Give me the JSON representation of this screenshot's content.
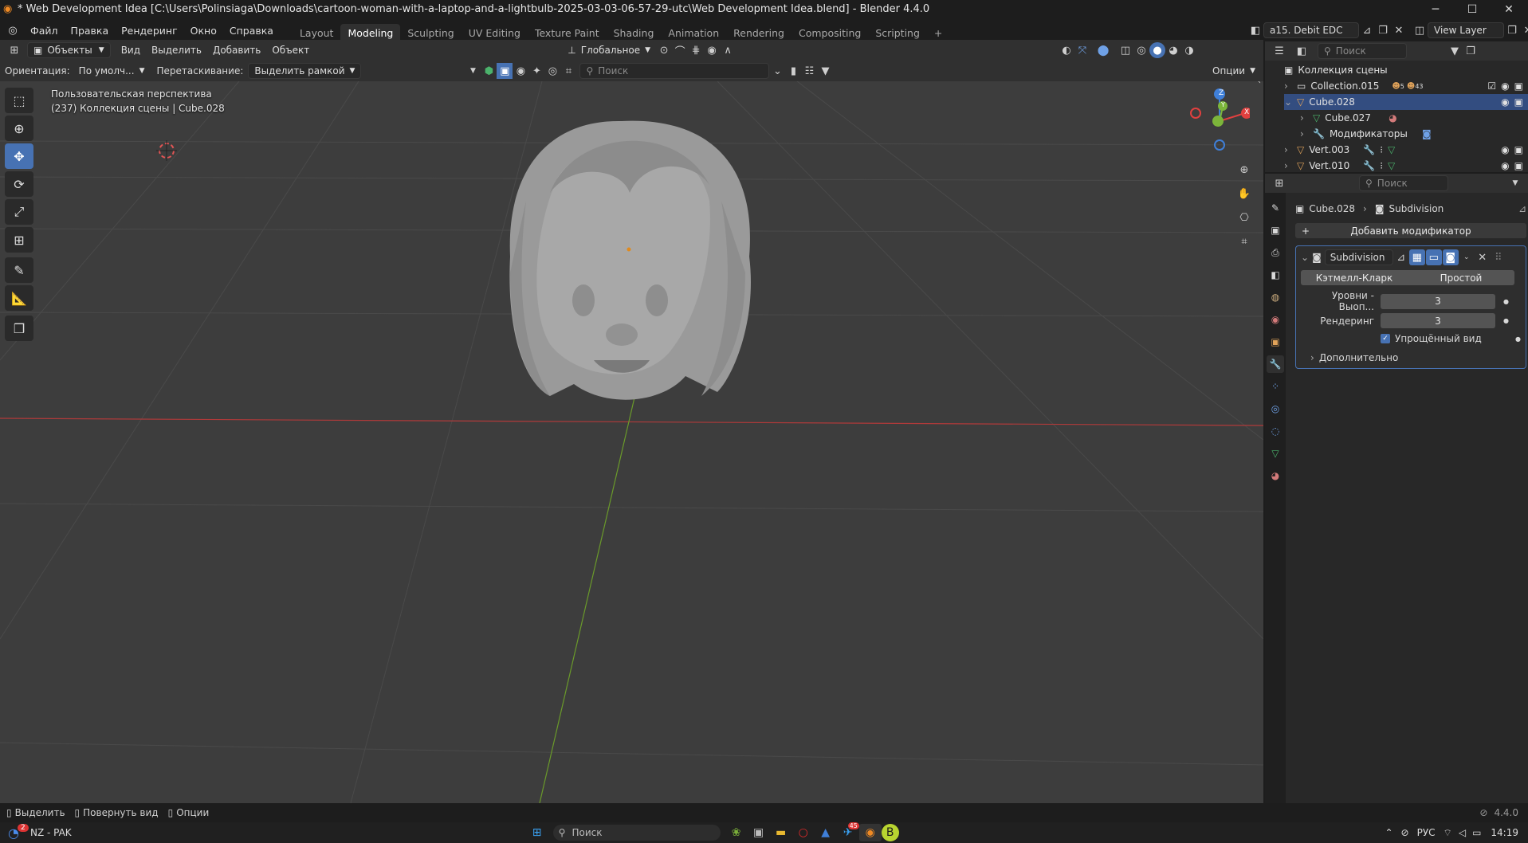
{
  "window": {
    "title": "* Web Development Idea [C:\\Users\\Polinsiaga\\Downloads\\cartoon-woman-with-a-laptop-and-a-lightbulb-2025-03-03-06-57-29-utc\\Web Development Idea.blend] - Blender 4.4.0",
    "minimize": "─",
    "maximize": "☐",
    "close": "✕"
  },
  "menu": [
    "Файл",
    "Правка",
    "Рендеринг",
    "Окно",
    "Справка"
  ],
  "workspaces": [
    "Layout",
    "Modeling",
    "Sculpting",
    "UV Editing",
    "Texture Paint",
    "Shading",
    "Animation",
    "Rendering",
    "Compositing",
    "Scripting"
  ],
  "active_workspace": "Modeling",
  "scene": {
    "name": "a15. Debit EDC",
    "view_layer": "View Layer"
  },
  "viewport_header": {
    "mode": "Объекты",
    "view": "Вид",
    "select": "Выделить",
    "add": "Добавить",
    "object": "Объект",
    "transform_orientation": "Глобальное"
  },
  "tool_settings": {
    "orientation_label": "Ориентация:",
    "orientation_value": "По умолч...",
    "drag_label": "Перетаскивание:",
    "drag_value": "Выделить рамкой",
    "search_placeholder": "Поиск",
    "options": "Опции"
  },
  "viewport": {
    "view_name": "Пользовательская перспектива",
    "context": "(237) Коллекция сцены | Cube.028",
    "gizmo_axes": {
      "x": "X",
      "y": "Y",
      "z": "Z"
    }
  },
  "outliner": {
    "search_placeholder": "Поиск",
    "root": "Коллекция сцены",
    "items": [
      {
        "label": "Collection.015",
        "badge1": "5",
        "badge2": "43"
      },
      {
        "label": "Cube.028"
      },
      {
        "label": "Cube.027"
      },
      {
        "label": "Модификаторы"
      },
      {
        "label": "Vert.003"
      },
      {
        "label": "Vert.010"
      }
    ]
  },
  "properties": {
    "search_placeholder": "Поиск",
    "breadcrumb_object": "Cube.028",
    "breadcrumb_modifier": "Subdivision",
    "add_modifier": "Добавить модификатор",
    "modifier": {
      "name": "Subdivision",
      "type_catmull": "Кэтмелл-Кларк",
      "type_simple": "Простой",
      "levels_label": "Уровни - Выоп...",
      "levels_value": "3",
      "render_label": "Рендеринг",
      "render_value": "3",
      "optimal_display": "Упрощённый вид",
      "advanced": "Дополнительно"
    }
  },
  "statusbar": {
    "select": "Выделить",
    "rotate_view": "Повернуть вид",
    "options": "Опции",
    "version": "4.4.0"
  },
  "taskbar": {
    "notification_count": "2",
    "weather_text": "NZ - PAK",
    "search_placeholder": "Поиск",
    "telegram_badge": "45",
    "language": "РУС",
    "time": "14:19"
  },
  "colors": {
    "accent": "#4772b3",
    "x_axis": "#e0403f",
    "y_axis": "#7cb53a",
    "z_axis": "#3f7fd8"
  }
}
